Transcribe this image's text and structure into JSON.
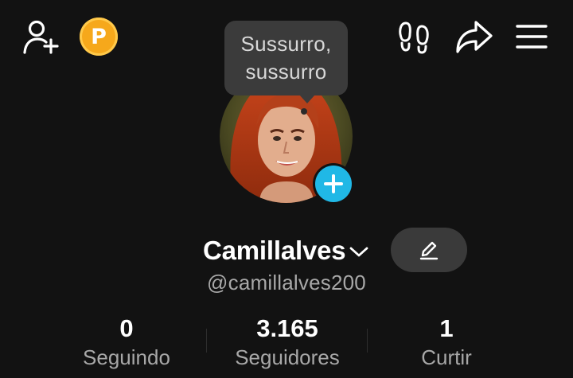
{
  "topbar": {
    "left_icons": [
      "add-friend-icon",
      "coin-icon"
    ],
    "coin_letter": "P",
    "right_icons": [
      "footprints-icon",
      "share-icon",
      "menu-icon"
    ]
  },
  "tooltip": {
    "line1": "Sussurro,",
    "line2": "sussurro"
  },
  "profile": {
    "name": "Camillalves",
    "name_icon": "chevron-down-icon",
    "edit_icon": "pencil-icon",
    "handle": "@camillalves200",
    "avatar_badge_icon": "plus-icon"
  },
  "stats": [
    {
      "value": "0",
      "label": "Seguindo"
    },
    {
      "value": "3.165",
      "label": "Seguidores"
    },
    {
      "value": "1",
      "label": "Curtir"
    }
  ],
  "colors": {
    "background": "#121212",
    "accent_cyan": "#20b8e6",
    "coin_gold": "#f6a81b",
    "muted_text": "#a8a8a8",
    "button_bg": "#3a3a3a"
  }
}
